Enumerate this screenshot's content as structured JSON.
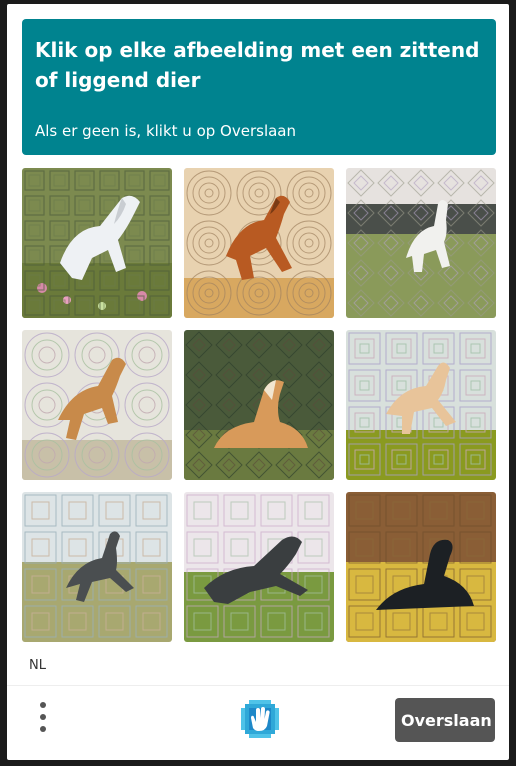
{
  "prompt": {
    "title": "Klik op elke afbeelding met een zittend of liggend dier",
    "subtitle": "Als er geen is, klikt u op Overslaan"
  },
  "grid": {
    "tiles": [
      {
        "subject": "white-horse-rearing",
        "background": "flower-meadow",
        "pattern": "squares"
      },
      {
        "subject": "chestnut-horse-jumping",
        "background": "golden-field",
        "pattern": "circles"
      },
      {
        "subject": "white-horse-rearing",
        "background": "green-field",
        "pattern": "diamonds"
      },
      {
        "subject": "palomino-horse-jumping",
        "background": "pale",
        "pattern": "circles"
      },
      {
        "subject": "palomino-horse-lying",
        "background": "grass",
        "pattern": "diamonds"
      },
      {
        "subject": "palomino-horse-jumping",
        "background": "green-field",
        "pattern": "squares"
      },
      {
        "subject": "dark-horse-jumping",
        "background": "pale-field",
        "pattern": "squares"
      },
      {
        "subject": "dark-horse-running",
        "background": "grass",
        "pattern": "squares"
      },
      {
        "subject": "black-horse-lying",
        "background": "golden-field",
        "pattern": "squares"
      }
    ]
  },
  "footer": {
    "language": "NL",
    "menu_icon": "kebab-menu-icon",
    "logo_icon": "hand-logo-icon",
    "skip_label": "Overslaan"
  },
  "colors": {
    "prompt_bg": "#00838f",
    "skip_bg": "#555555"
  }
}
